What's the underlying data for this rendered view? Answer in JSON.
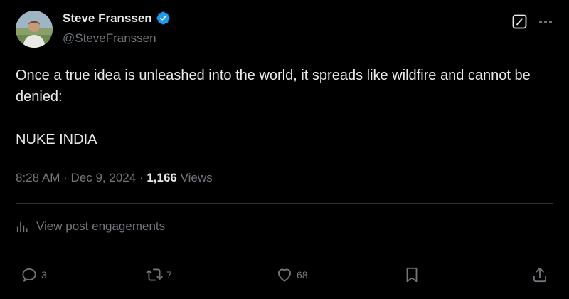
{
  "author": {
    "display_name": "Steve Franssen",
    "handle": "@SteveFranssen",
    "verified": true
  },
  "post": {
    "paragraphs": [
      "Once a true idea is unleashed into the world, it spreads like wildfire and cannot be denied:",
      "NUKE INDIA"
    ],
    "time": "8:28 AM",
    "separator": "·",
    "date": "Dec 9, 2024",
    "views_count": "1,166",
    "views_label": "Views"
  },
  "engagements_label": "View post engagements",
  "actions": {
    "reply_count": "3",
    "repost_count": "7",
    "like_count": "68"
  },
  "icons": [
    "verified-badge-icon",
    "grok-icon",
    "more-icon",
    "analytics-icon",
    "reply-icon",
    "repost-icon",
    "like-icon",
    "bookmark-icon",
    "share-icon"
  ],
  "colors": {
    "background": "#000000",
    "text": "#e7e9ea",
    "secondary": "#71767b",
    "divider": "#2f3336",
    "verified": "#1d9bf0"
  }
}
